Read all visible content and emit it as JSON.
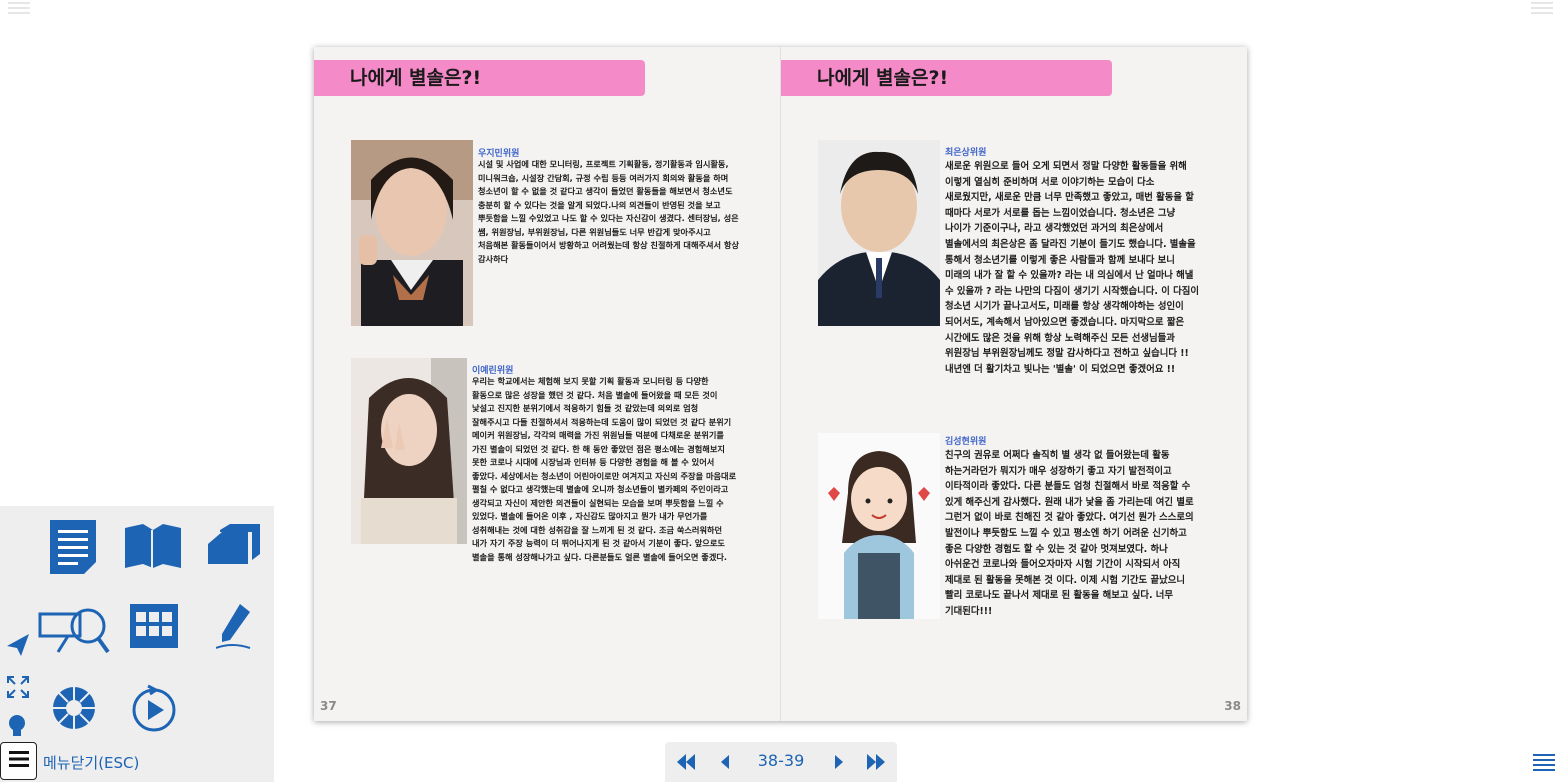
{
  "book": {
    "left_page": {
      "banner_title": "나에게 별솔은?!",
      "page_number": "37",
      "entries": [
        {
          "name": "우지민위원",
          "text": "시설 및 사업에 대한 모니터링, 프로젝트 기획활동, 정기활동과 임시활동, 미니워크숍, 시설장 간담회, 규정 수립 등등 여러가지 회의와 활동을 하며 청소년이 할 수 없을 것 같다고 생각이 들었던 활동들을 해보면서 청소년도 충분히 할 수 있다는 것을 알게 되었다.나의 의견들이 반영된 것을 보고 뿌듯함을 느낄 수있었고 나도 할 수 있다는 자신감이 생겼다. 센터장님, 성은 쌤, 위원장님, 부위원장님, 다른 위원님들도 너무 반갑게 맞아주시고 처음해본 활동들이어서 방황하고 어려웠는데 항상 친절하게 대해주셔서 항상 감사하다"
        },
        {
          "name": "이예린위원",
          "text": "우리는 학교에서는 체험해 보지 못할 기획 활동과 모니터링 등 다양한 활동으로 많은 성장을 했던 것 같다. 처음 별솔에 들어왔을 때 모든 것이 낯설고 진지한 분위기에서 적응하기 힘들 것 같았는데 의외로 엄청 잘해주시고 다들 친절하셔서 적응하는데 도움이 많이 되었던 것 같다 분위기 메이커 위원장님, 각각의 매력을 가진 위원님들 덕분에 다채로운 분위기를 가진 별솔이 되었던 것 같다. 한 해 동안 좋았던 점은 평소에는 경험해보지 못한 코로나 시대에 시장님과 인터뷰 등 다양한 경험을 해 볼 수 있어서 좋았다. 세상에서는 청소년이 어린아이로만 여겨지고 자신의 주장을 마음대로 펼칠 수 없다고 생각했는데 별솔에 오니까 청소년들이 별카페의 주인이라고 생각되고 자신이 제안한 의견들이 실현되는 모습을 보며 뿌듯함을 느낄 수 있었다. 별솔에 들어온 이후 , 자신감도 많아지고 뭔가 내가 무언가를 성취해내는 것에 대한 성취감을 잘 느끼게 된 것 같다. 조금 쑥스러워하던 내가 자기 주장 능력이 더 뛰어나지게 된 것 같아서 기분이 좋다. 앞으로도 별솔을 통해 성장해나가고 싶다. 다른분들도 얼른 별솔에 들어오면 좋겠다."
        }
      ]
    },
    "right_page": {
      "banner_title": "나에게 별솔은?!",
      "page_number": "38",
      "entries": [
        {
          "name": "최은상위원",
          "text": "새로운 위원으로 들어 오게 되면서 정말 다양한 활동들을 위해 이렇게 열심히 준비하며 서로 이야기하는 모습이 다소 새로웠지만, 새로운 만큼 너무 만족했고 좋았고, 매번 활동을 할 때마다 서로가 서로를 돕는 느낌이었습니다. 청소년은 그냥 나이가 기준이구나, 라고 생각했었던 과거의 최은상에서 별솔에서의 최은상은 좀 달라진 기분이 들기도 했습니다. 별솔을 통해서 청소년기를 이렇게 좋은 사람들과 함께 보내다 보니 미래의 내가 잘 할 수 있을까? 라는 내 의심에서 난 얼마나 해낼 수 있을까 ? 라는 나만의 다짐이 생기기 시작했습니다. 이 다짐이 청소년 시기가 끝나고서도, 미래를 항상 생각해야하는 성인이 되어서도, 계속해서 남아있으면 좋겠습니다. 마지막으로 짧은 시간에도 많은 것을 위해 항상 노력해주신 모든 선생님들과 위원장님 부위원장님께도 정말 감사하다고 전하고 싶습니다 !! 내년엔 더 활기차고 빛나는 '별솔' 이 되었으면 좋겠어요 !!"
        },
        {
          "name": "김성현위원",
          "text": "친구의 권유로 어쩌다 솔직히 별 생각 없 들어왔는데 활동 하는거라던가 뭐지가 매우 성장하기 좋고 자기 발전적이고 이타적이라 좋았다. 다른 분들도 엄청 친절해서 바로 적응할 수 있게 해주신게 감사했다. 원래 내가 낯을 좀 가리는데 여긴 별로 그런거 없이 바로 친해진 것 같아 좋았다. 여기선 뭔가 스스로의 발전이나 뿌듯함도 느낄 수 있고 평소엔 하기 어려운 신기하고 좋은 다양한 경험도 할 수 있는 것 같아 멋져보였다. 하나 아쉬운건 코로나와 들어오자마자 시험 기간이 시작되서 아직 제대로 된 활동을 못해본 것 이다. 이제 시험 기간도 끝났으니 빨리 코로나도 끝나서 제대로 된 활동을 해보고 싶다. 너무 기대된다!!!"
        }
      ]
    }
  },
  "menu": {
    "close_label": "메뉴닫기(ESC)",
    "tools": [
      "document-icon",
      "book-open-icon",
      "pages-icon",
      "zoom-icon",
      "thumbnail-grid-icon",
      "pen-icon",
      "camera-shutter-icon",
      "play-icon"
    ],
    "side_tools": [
      "send-icon",
      "fullscreen-icon",
      "lightbulb-icon"
    ]
  },
  "navigation": {
    "page_indicator": "38-39"
  },
  "colors": {
    "accent_blue": "#1d64b5",
    "banner_pink": "#f58ac8",
    "name_blue": "#3f66c9"
  }
}
